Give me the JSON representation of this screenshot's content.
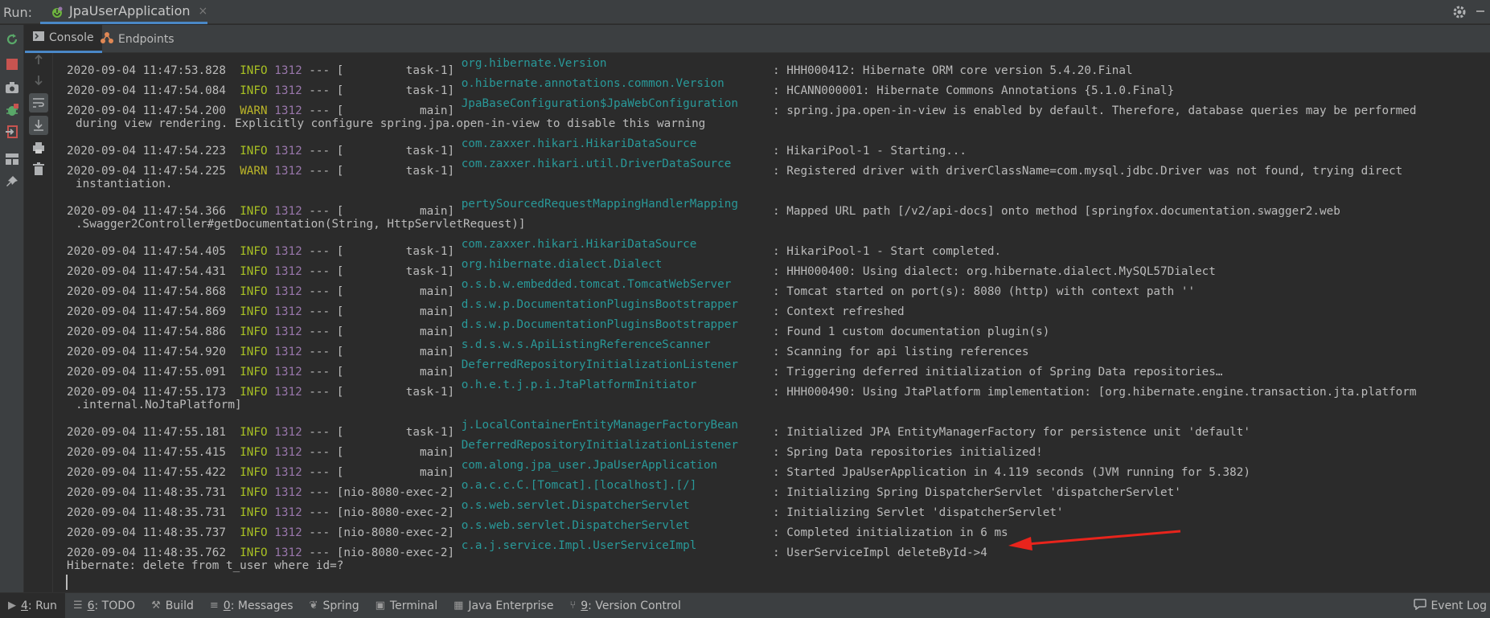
{
  "run_header": {
    "label": "Run:",
    "tab_title": "JpaUserApplication",
    "tab_close": "×"
  },
  "subtabs": {
    "console": "Console",
    "endpoints": "Endpoints"
  },
  "log_lines": [
    {
      "ts": "2020-09-04 11:47:53.828",
      "level": "INFO",
      "pid": "1312",
      "sep": " --- [",
      "thread": "         task-1]",
      "logger": "org.hibernate.Version",
      "msg": ": HHH000412: Hibernate ORM core version 5.4.20.Final",
      "cont": ""
    },
    {
      "ts": "2020-09-04 11:47:54.084",
      "level": "INFO",
      "pid": "1312",
      "sep": " --- [",
      "thread": "         task-1]",
      "logger": "o.hibernate.annotations.common.Version",
      "msg": ": HCANN000001: Hibernate Commons Annotations {5.1.0.Final}",
      "cont": ""
    },
    {
      "ts": "2020-09-04 11:47:54.200",
      "level": "WARN",
      "pid": "1312",
      "sep": " --- [",
      "thread": "           main]",
      "logger": "JpaBaseConfiguration$JpaWebConfiguration",
      "msg": ": spring.jpa.open-in-view is enabled by default. Therefore, database queries may be performed",
      "cont": "during view rendering. Explicitly configure spring.jpa.open-in-view to disable this warning"
    },
    {
      "ts": "2020-09-04 11:47:54.223",
      "level": "INFO",
      "pid": "1312",
      "sep": " --- [",
      "thread": "         task-1]",
      "logger": "com.zaxxer.hikari.HikariDataSource",
      "msg": ": HikariPool-1 - Starting...",
      "cont": ""
    },
    {
      "ts": "2020-09-04 11:47:54.225",
      "level": "WARN",
      "pid": "1312",
      "sep": " --- [",
      "thread": "         task-1]",
      "logger": "com.zaxxer.hikari.util.DriverDataSource",
      "msg": ": Registered driver with driverClassName=com.mysql.jdbc.Driver was not found, trying direct",
      "cont": "instantiation."
    },
    {
      "ts": "2020-09-04 11:47:54.366",
      "level": "INFO",
      "pid": "1312",
      "sep": " --- [",
      "thread": "           main]",
      "logger": "pertySourcedRequestMappingHandlerMapping",
      "msg": ": Mapped URL path [/v2/api-docs] onto method [springfox.documentation.swagger2.web",
      "cont": ".Swagger2Controller#getDocumentation(String, HttpServletRequest)]"
    },
    {
      "ts": "2020-09-04 11:47:54.405",
      "level": "INFO",
      "pid": "1312",
      "sep": " --- [",
      "thread": "         task-1]",
      "logger": "com.zaxxer.hikari.HikariDataSource",
      "msg": ": HikariPool-1 - Start completed.",
      "cont": ""
    },
    {
      "ts": "2020-09-04 11:47:54.431",
      "level": "INFO",
      "pid": "1312",
      "sep": " --- [",
      "thread": "         task-1]",
      "logger": "org.hibernate.dialect.Dialect",
      "msg": ": HHH000400: Using dialect: org.hibernate.dialect.MySQL57Dialect",
      "cont": ""
    },
    {
      "ts": "2020-09-04 11:47:54.868",
      "level": "INFO",
      "pid": "1312",
      "sep": " --- [",
      "thread": "           main]",
      "logger": "o.s.b.w.embedded.tomcat.TomcatWebServer",
      "msg": ": Tomcat started on port(s): 8080 (http) with context path ''",
      "cont": ""
    },
    {
      "ts": "2020-09-04 11:47:54.869",
      "level": "INFO",
      "pid": "1312",
      "sep": " --- [",
      "thread": "           main]",
      "logger": "d.s.w.p.DocumentationPluginsBootstrapper",
      "msg": ": Context refreshed",
      "cont": ""
    },
    {
      "ts": "2020-09-04 11:47:54.886",
      "level": "INFO",
      "pid": "1312",
      "sep": " --- [",
      "thread": "           main]",
      "logger": "d.s.w.p.DocumentationPluginsBootstrapper",
      "msg": ": Found 1 custom documentation plugin(s)",
      "cont": ""
    },
    {
      "ts": "2020-09-04 11:47:54.920",
      "level": "INFO",
      "pid": "1312",
      "sep": " --- [",
      "thread": "           main]",
      "logger": "s.d.s.w.s.ApiListingReferenceScanner",
      "msg": ": Scanning for api listing references",
      "cont": ""
    },
    {
      "ts": "2020-09-04 11:47:55.091",
      "level": "INFO",
      "pid": "1312",
      "sep": " --- [",
      "thread": "           main]",
      "logger": "DeferredRepositoryInitializationListener",
      "msg": ": Triggering deferred initialization of Spring Data repositories…",
      "cont": ""
    },
    {
      "ts": "2020-09-04 11:47:55.173",
      "level": "INFO",
      "pid": "1312",
      "sep": " --- [",
      "thread": "         task-1]",
      "logger": "o.h.e.t.j.p.i.JtaPlatformInitiator",
      "msg": ": HHH000490: Using JtaPlatform implementation: [org.hibernate.engine.transaction.jta.platform",
      "cont": ".internal.NoJtaPlatform]"
    },
    {
      "ts": "2020-09-04 11:47:55.181",
      "level": "INFO",
      "pid": "1312",
      "sep": " --- [",
      "thread": "         task-1]",
      "logger": "j.LocalContainerEntityManagerFactoryBean",
      "msg": ": Initialized JPA EntityManagerFactory for persistence unit 'default'",
      "cont": ""
    },
    {
      "ts": "2020-09-04 11:47:55.415",
      "level": "INFO",
      "pid": "1312",
      "sep": " --- [",
      "thread": "           main]",
      "logger": "DeferredRepositoryInitializationListener",
      "msg": ": Spring Data repositories initialized!",
      "cont": ""
    },
    {
      "ts": "2020-09-04 11:47:55.422",
      "level": "INFO",
      "pid": "1312",
      "sep": " --- [",
      "thread": "           main]",
      "logger": "com.along.jpa_user.JpaUserApplication",
      "msg": ": Started JpaUserApplication in 4.119 seconds (JVM running for 5.382)",
      "cont": ""
    },
    {
      "ts": "2020-09-04 11:48:35.731",
      "level": "INFO",
      "pid": "1312",
      "sep": " --- [",
      "thread": "nio-8080-exec-2]",
      "logger": "o.a.c.c.C.[Tomcat].[localhost].[/]",
      "msg": ": Initializing Spring DispatcherServlet 'dispatcherServlet'",
      "cont": ""
    },
    {
      "ts": "2020-09-04 11:48:35.731",
      "level": "INFO",
      "pid": "1312",
      "sep": " --- [",
      "thread": "nio-8080-exec-2]",
      "logger": "o.s.web.servlet.DispatcherServlet",
      "msg": ": Initializing Servlet 'dispatcherServlet'",
      "cont": ""
    },
    {
      "ts": "2020-09-04 11:48:35.737",
      "level": "INFO",
      "pid": "1312",
      "sep": " --- [",
      "thread": "nio-8080-exec-2]",
      "logger": "o.s.web.servlet.DispatcherServlet",
      "msg": ": Completed initialization in 6 ms",
      "cont": ""
    },
    {
      "ts": "2020-09-04 11:48:35.762",
      "level": "INFO",
      "pid": "1312",
      "sep": " --- [",
      "thread": "nio-8080-exec-2]",
      "logger": "c.a.j.service.Impl.UserServiceImpl",
      "msg": ": UserServiceImpl deleteById->4",
      "cont": ""
    }
  ],
  "hibernate_line": "Hibernate: delete from t_user where id=?",
  "bottom_tabs": [
    {
      "mnemonic": "4",
      "label": ": Run",
      "icon": "play-icon"
    },
    {
      "mnemonic": "6",
      "label": ": TODO",
      "icon": "list-icon"
    },
    {
      "mnemonic": "",
      "label": "Build",
      "icon": "hammer-icon"
    },
    {
      "mnemonic": "0",
      "label": ": Messages",
      "icon": "messages-icon"
    },
    {
      "mnemonic": "",
      "label": "Spring",
      "icon": "spring-icon"
    },
    {
      "mnemonic": "",
      "label": "Terminal",
      "icon": "terminal-icon"
    },
    {
      "mnemonic": "",
      "label": "Java Enterprise",
      "icon": "java-enterprise-icon"
    },
    {
      "mnemonic": "9",
      "label": ": Version Control",
      "icon": "branch-icon"
    }
  ],
  "event_log": "Event Log",
  "colors": {
    "info": "#a8c023",
    "warn": "#bbb529",
    "pid": "#9876aa",
    "logger": "#299999",
    "annotation_arrow": "#e8241c",
    "accent": "#4a88c7"
  }
}
